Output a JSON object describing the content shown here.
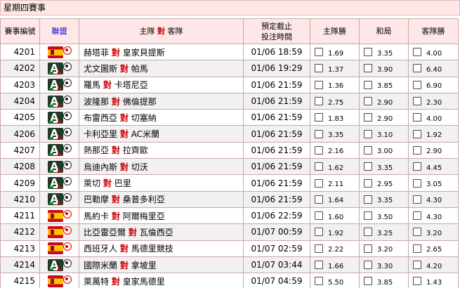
{
  "header": {
    "title": "星期四賽事"
  },
  "columns": {
    "match_no": "賽事編號",
    "league": "聯盟",
    "home_vs_away": {
      "home": "主隊",
      "vs": "對",
      "away": "客隊"
    },
    "kickoff": [
      "預定截止",
      "投注時間"
    ],
    "home_win": "主隊勝",
    "draw": "和局",
    "away_win": "客隊勝"
  },
  "leagues": {
    "la_liga": {
      "icon": "spain-flag-icon",
      "color": "#c60b1e"
    },
    "serie_a": {
      "icon": "serie-a-icon",
      "color": "#1f3a25"
    }
  },
  "rows": [
    {
      "no": "4201",
      "league": "la_liga",
      "home": "赫塔菲",
      "away": "皇家貝提斯",
      "time": "01/06 18:59",
      "home_odds": "1.69",
      "draw_odds": "3.35",
      "away_odds": "4.00"
    },
    {
      "no": "4202",
      "league": "serie_a",
      "home": "尤文圖斯",
      "away": "帕馬",
      "time": "01/06 19:29",
      "home_odds": "1.37",
      "draw_odds": "3.90",
      "away_odds": "6.40"
    },
    {
      "no": "4203",
      "league": "serie_a",
      "home": "羅馬",
      "away": "卡塔尼亞",
      "time": "01/06 21:59",
      "home_odds": "1.36",
      "draw_odds": "3.85",
      "away_odds": "6.90"
    },
    {
      "no": "4204",
      "league": "serie_a",
      "home": "波隆那",
      "away": "佛倫提那",
      "time": "01/06 21:59",
      "home_odds": "2.75",
      "draw_odds": "2.90",
      "away_odds": "2.30"
    },
    {
      "no": "4205",
      "league": "serie_a",
      "home": "布雷西亞",
      "away": "切塞納",
      "time": "01/06 21:59",
      "home_odds": "1.83",
      "draw_odds": "2.90",
      "away_odds": "4.00"
    },
    {
      "no": "4206",
      "league": "serie_a",
      "home": "卡利亞里",
      "away": "AC米蘭",
      "time": "01/06 21:59",
      "home_odds": "3.35",
      "draw_odds": "3.10",
      "away_odds": "1.92"
    },
    {
      "no": "4207",
      "league": "serie_a",
      "home": "熱那亞",
      "away": "拉齊歐",
      "time": "01/06 21:59",
      "home_odds": "2.16",
      "draw_odds": "3.00",
      "away_odds": "2.90"
    },
    {
      "no": "4208",
      "league": "serie_a",
      "home": "烏迪內斯",
      "away": "切沃",
      "time": "01/06 21:59",
      "home_odds": "1.62",
      "draw_odds": "3.35",
      "away_odds": "4.45"
    },
    {
      "no": "4209",
      "league": "serie_a",
      "home": "萊切",
      "away": "巴里",
      "time": "01/06 21:59",
      "home_odds": "2.11",
      "draw_odds": "2.95",
      "away_odds": "3.05"
    },
    {
      "no": "4210",
      "league": "serie_a",
      "home": "巴勒摩",
      "away": "桑普多利亞",
      "time": "01/06 21:59",
      "home_odds": "1.64",
      "draw_odds": "3.35",
      "away_odds": "4.30"
    },
    {
      "no": "4211",
      "league": "la_liga",
      "home": "馬約卡",
      "away": "阿爾梅里亞",
      "time": "01/06 22:59",
      "home_odds": "1.60",
      "draw_odds": "3.50",
      "away_odds": "4.30"
    },
    {
      "no": "4212",
      "league": "la_liga",
      "home": "比亞雷亞爾",
      "away": "瓦倫西亞",
      "time": "01/07 00:59",
      "home_odds": "1.92",
      "draw_odds": "3.25",
      "away_odds": "3.20"
    },
    {
      "no": "4213",
      "league": "la_liga",
      "home": "西班牙人",
      "away": "馬德里競技",
      "time": "01/07 02:59",
      "home_odds": "2.22",
      "draw_odds": "3.20",
      "away_odds": "2.65"
    },
    {
      "no": "4214",
      "league": "serie_a",
      "home": "國際米蘭",
      "away": "拿坡里",
      "time": "01/07 03:44",
      "home_odds": "1.66",
      "draw_odds": "3.30",
      "away_odds": "4.20"
    },
    {
      "no": "4215",
      "league": "la_liga",
      "home": "萊萬特",
      "away": "皇家馬德里",
      "time": "01/07 04:59",
      "home_odds": "5.50",
      "draw_odds": "3.85",
      "away_odds": "1.43"
    }
  ]
}
